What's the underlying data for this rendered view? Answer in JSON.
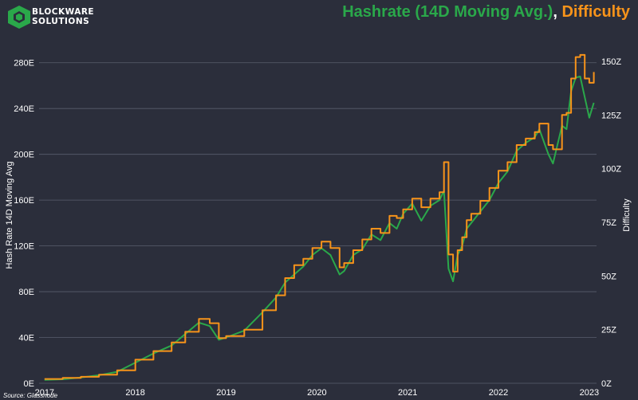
{
  "brand": {
    "line1": "BLOCKWARE",
    "line2": "SOLUTIONS"
  },
  "title": {
    "hashrate": "Hashrate (14D Moving Avg.)",
    "separator": ",",
    "difficulty": "Difficulty"
  },
  "source": "Source: Glassnode",
  "colors": {
    "background": "#2b2e3b",
    "hashrate": "#2aa84a",
    "difficulty": "#f7931a",
    "grid": "#5a5e6e"
  },
  "chart_data": {
    "type": "line",
    "title": "Hashrate (14D Moving Avg.), Difficulty",
    "ylabel_left": "Hash Rate 14D Moving Avg",
    "ylabel_right": "Difficulty",
    "x_ticks": [
      "2017",
      "2018",
      "2019",
      "2020",
      "2021",
      "2022",
      "2023"
    ],
    "y_left_ticks": [
      "0E",
      "40E",
      "80E",
      "120E",
      "160E",
      "200E",
      "240E",
      "280E"
    ],
    "y_left_lim": [
      0,
      300
    ],
    "y_right_ticks": [
      "0Z",
      "25Z",
      "50Z",
      "75Z",
      "100Z",
      "125Z",
      "150Z"
    ],
    "y_right_lim": [
      0,
      160
    ],
    "grid": "horizontal",
    "x_lim": [
      2016.94,
      2023.08
    ],
    "series": [
      {
        "name": "Hashrate (14D Moving Avg.)",
        "axis": "left",
        "color": "#2aa84a",
        "x": [
          2017.0,
          2017.2,
          2017.4,
          2017.6,
          2017.8,
          2018.0,
          2018.2,
          2018.4,
          2018.55,
          2018.7,
          2018.82,
          2018.92,
          2019.0,
          2019.2,
          2019.4,
          2019.55,
          2019.65,
          2019.75,
          2019.85,
          2019.95,
          2020.05,
          2020.15,
          2020.25,
          2020.3,
          2020.4,
          2020.5,
          2020.6,
          2020.7,
          2020.8,
          2020.88,
          2020.95,
          2021.05,
          2021.15,
          2021.25,
          2021.35,
          2021.4,
          2021.45,
          2021.5,
          2021.55,
          2021.6,
          2021.65,
          2021.7,
          2021.8,
          2021.9,
          2022.0,
          2022.1,
          2022.2,
          2022.3,
          2022.4,
          2022.45,
          2022.55,
          2022.6,
          2022.7,
          2022.75,
          2022.8,
          2022.85,
          2022.9,
          2022.95,
          2023.0,
          2023.05
        ],
        "values": [
          3,
          3.5,
          5,
          7,
          10,
          18,
          26,
          33,
          43,
          53,
          50,
          38,
          40,
          46,
          62,
          75,
          88,
          95,
          102,
          112,
          118,
          112,
          95,
          98,
          112,
          117,
          130,
          125,
          140,
          135,
          148,
          157,
          142,
          155,
          160,
          168,
          100,
          89,
          112,
          120,
          135,
          140,
          150,
          160,
          175,
          185,
          203,
          210,
          215,
          222,
          200,
          192,
          225,
          222,
          255,
          267,
          268,
          250,
          232,
          245
        ]
      },
      {
        "name": "Difficulty",
        "axis": "right",
        "color": "#f7931a",
        "x": [
          2017.0,
          2017.2,
          2017.4,
          2017.6,
          2017.8,
          2018.0,
          2018.2,
          2018.4,
          2018.55,
          2018.7,
          2018.82,
          2018.92,
          2019.0,
          2019.2,
          2019.4,
          2019.55,
          2019.65,
          2019.75,
          2019.85,
          2019.95,
          2020.05,
          2020.15,
          2020.25,
          2020.3,
          2020.4,
          2020.5,
          2020.6,
          2020.7,
          2020.8,
          2020.88,
          2020.95,
          2021.05,
          2021.15,
          2021.25,
          2021.35,
          2021.4,
          2021.45,
          2021.5,
          2021.55,
          2021.6,
          2021.65,
          2021.7,
          2021.8,
          2021.9,
          2022.0,
          2022.1,
          2022.2,
          2022.3,
          2022.4,
          2022.45,
          2022.55,
          2022.6,
          2022.7,
          2022.75,
          2022.8,
          2022.85,
          2022.9,
          2022.95,
          2023.0,
          2023.05
        ],
        "values": [
          2,
          2.5,
          3,
          4,
          6,
          11,
          15,
          19,
          24,
          30,
          28,
          21,
          22,
          25,
          34,
          41,
          49,
          55,
          58,
          63,
          66,
          63,
          54,
          56,
          62,
          67,
          72,
          70,
          78,
          77,
          81,
          86,
          82,
          86,
          89,
          103,
          60,
          52,
          62,
          68,
          76,
          79,
          85,
          91,
          99,
          103,
          111,
          114,
          117,
          121,
          111,
          109,
          125,
          126,
          142,
          152,
          153,
          142,
          140,
          145
        ]
      }
    ]
  }
}
